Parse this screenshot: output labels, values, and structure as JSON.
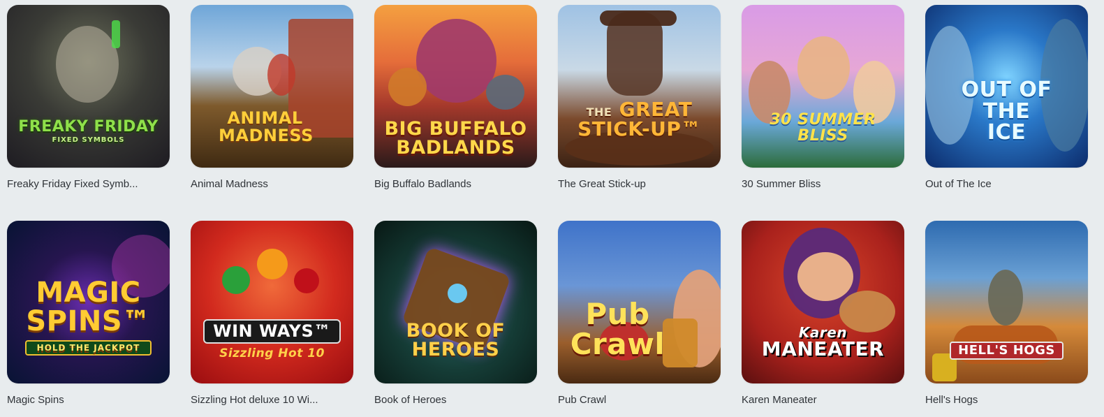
{
  "games": [
    {
      "title": "Freaky Friday Fixed Symb...",
      "logo": "FREAKY FRIDAY",
      "logo_sub": "FIXED SYMBOLS"
    },
    {
      "title": "Animal Madness",
      "logo": "ANIMAL MADNESS"
    },
    {
      "title": "Big Buffalo Badlands",
      "logo": "BIG BUFFALO BADLANDS"
    },
    {
      "title": "The Great Stick-up",
      "logo_the": "THE",
      "logo": "GREAT STICK-UP™"
    },
    {
      "title": "30 Summer Bliss",
      "logo": "30 SUMMER BLISS"
    },
    {
      "title": "Out of The Ice",
      "logo": "OUT OF THE ICE"
    },
    {
      "title": "Magic Spins",
      "logo": "MAGIC SPINS™",
      "logo_sub": "HOLD THE JACKPOT"
    },
    {
      "title": "Sizzling Hot deluxe 10 Wi...",
      "logo": "WIN WAYS™",
      "logo_sub": "Sizzling Hot 10"
    },
    {
      "title": "Book of Heroes",
      "logo": "BOOK OF HEROES"
    },
    {
      "title": "Pub Crawl",
      "logo": "Pub Crawl"
    },
    {
      "title": "Karen Maneater",
      "logo_script": "Karen",
      "logo": "MANEATER"
    },
    {
      "title": "Hell's Hogs",
      "logo": "HELL'S HOGS"
    }
  ]
}
